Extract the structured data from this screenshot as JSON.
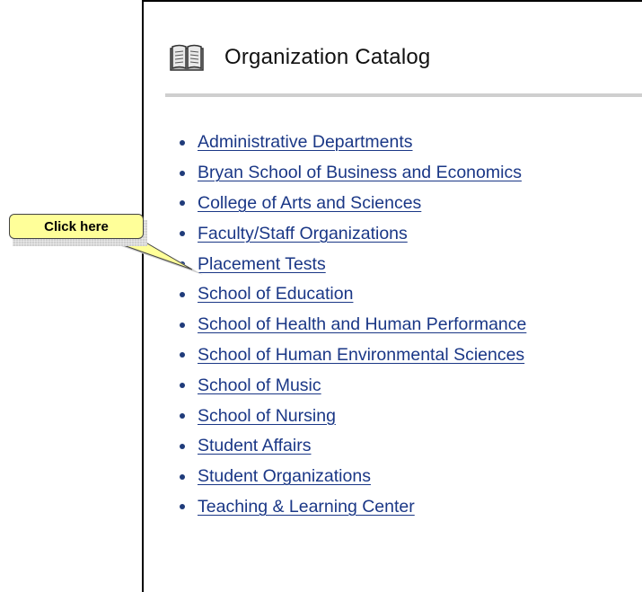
{
  "header": {
    "title": "Organization Catalog",
    "icon": "book-icon"
  },
  "catalog": {
    "items": [
      "Administrative Departments",
      "Bryan School of Business and Economics",
      "College of Arts and Sciences",
      "Faculty/Staff Organizations",
      "Placement Tests",
      "School of Education",
      "School of Health and Human Performance",
      "School of Human Environmental Sciences",
      "School of Music",
      "School of Nursing",
      "Student Affairs",
      "Student Organizations",
      "Teaching & Learning Center"
    ]
  },
  "callout": {
    "text": "Click here",
    "color": "#ffff99"
  },
  "colors": {
    "link": "#1a3786",
    "rule": "#cfcfcf"
  }
}
